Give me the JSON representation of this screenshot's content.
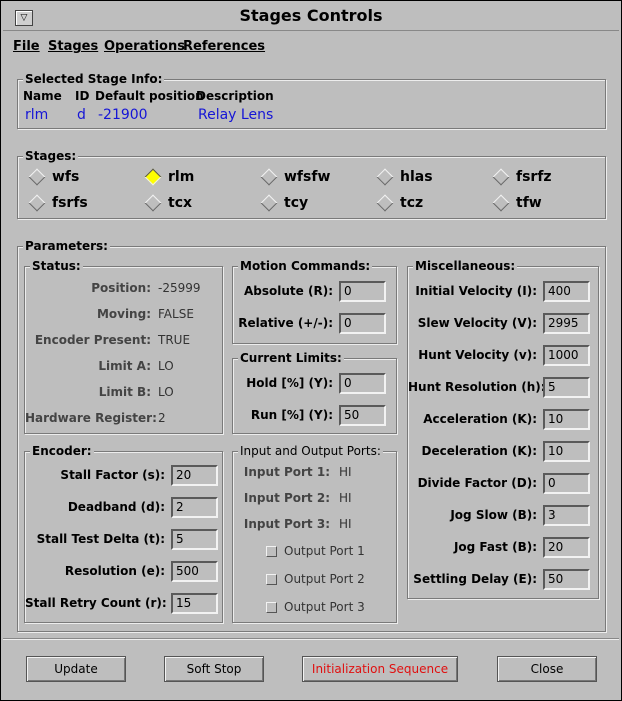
{
  "window": {
    "title": "Stages Controls",
    "menu_glyph": "▽"
  },
  "menu": [
    "File",
    "Stages",
    "Operations",
    "References"
  ],
  "selected_stage": {
    "group_label": "Selected Stage Info:",
    "headers": [
      "Name",
      "ID",
      "Default position",
      "Description"
    ],
    "values": [
      "rlm",
      "d",
      "-21900",
      "Relay Lens"
    ]
  },
  "stages": {
    "group_label": "Stages:",
    "items": [
      {
        "label": "wfs",
        "selected": false
      },
      {
        "label": "rlm",
        "selected": true
      },
      {
        "label": "wfsfw",
        "selected": false
      },
      {
        "label": "hlas",
        "selected": false
      },
      {
        "label": "fsrfz",
        "selected": false
      },
      {
        "label": "fsrfs",
        "selected": false
      },
      {
        "label": "tcx",
        "selected": false
      },
      {
        "label": "tcy",
        "selected": false
      },
      {
        "label": "tcz",
        "selected": false
      },
      {
        "label": "tfw",
        "selected": false
      }
    ]
  },
  "parameters": {
    "group_label": "Parameters:"
  },
  "status": {
    "group_label": "Status:",
    "rows": [
      {
        "label": "Position:",
        "value": "-25999"
      },
      {
        "label": "Moving:",
        "value": "FALSE"
      },
      {
        "label": "Encoder Present:",
        "value": "TRUE"
      },
      {
        "label": "Limit A:",
        "value": "LO"
      },
      {
        "label": "Limit B:",
        "value": "LO"
      },
      {
        "label": "Hardware Register:",
        "value": "2"
      }
    ]
  },
  "motion": {
    "group_label": "Motion Commands:",
    "rows": [
      {
        "label": "Absolute (R):",
        "value": "0"
      },
      {
        "label": "Relative (+/-):",
        "value": "0"
      }
    ]
  },
  "limits": {
    "group_label": "Current Limits:",
    "rows": [
      {
        "label": "Hold [%] (Y):",
        "value": "0"
      },
      {
        "label": "Run [%] (Y):",
        "value": "50"
      }
    ]
  },
  "encoder": {
    "group_label": "Encoder:",
    "rows": [
      {
        "label": "Stall Factor (s):",
        "value": "20"
      },
      {
        "label": "Deadband (d):",
        "value": "2"
      },
      {
        "label": "Stall Test Delta (t):",
        "value": "5"
      },
      {
        "label": "Resolution (e):",
        "value": "500"
      },
      {
        "label": "Stall Retry Count (r):",
        "value": "15"
      }
    ]
  },
  "io": {
    "group_label": "Input and Output Ports:",
    "inputs": [
      {
        "label": "Input Port 1:",
        "value": "HI"
      },
      {
        "label": "Input Port 2:",
        "value": "HI"
      },
      {
        "label": "Input Port 3:",
        "value": "HI"
      }
    ],
    "outputs": [
      "Output Port 1",
      "Output Port 2",
      "Output Port 3"
    ]
  },
  "misc": {
    "group_label": "Miscellaneous:",
    "rows": [
      {
        "label": "Initial Velocity (I):",
        "value": "400"
      },
      {
        "label": "Slew Velocity (V):",
        "value": "2995"
      },
      {
        "label": "Hunt Velocity (v):",
        "value": "1000"
      },
      {
        "label": "Hunt Resolution (h):",
        "value": "5"
      },
      {
        "label": "Acceleration (K):",
        "value": "10"
      },
      {
        "label": "Deceleration (K):",
        "value": "10"
      },
      {
        "label": "Divide Factor (D):",
        "value": "0"
      },
      {
        "label": "Jog Slow (B):",
        "value": "3"
      },
      {
        "label": "Jog Fast (B):",
        "value": "20"
      },
      {
        "label": "Settling Delay (E):",
        "value": "50"
      }
    ]
  },
  "buttons": {
    "update": "Update",
    "soft_stop": "Soft Stop",
    "init": "Initialization Sequence",
    "close": "Close"
  },
  "colors": {
    "accent_blue": "#1515d6",
    "init_text": "#e01010",
    "radio_selected": "#ffff00"
  }
}
